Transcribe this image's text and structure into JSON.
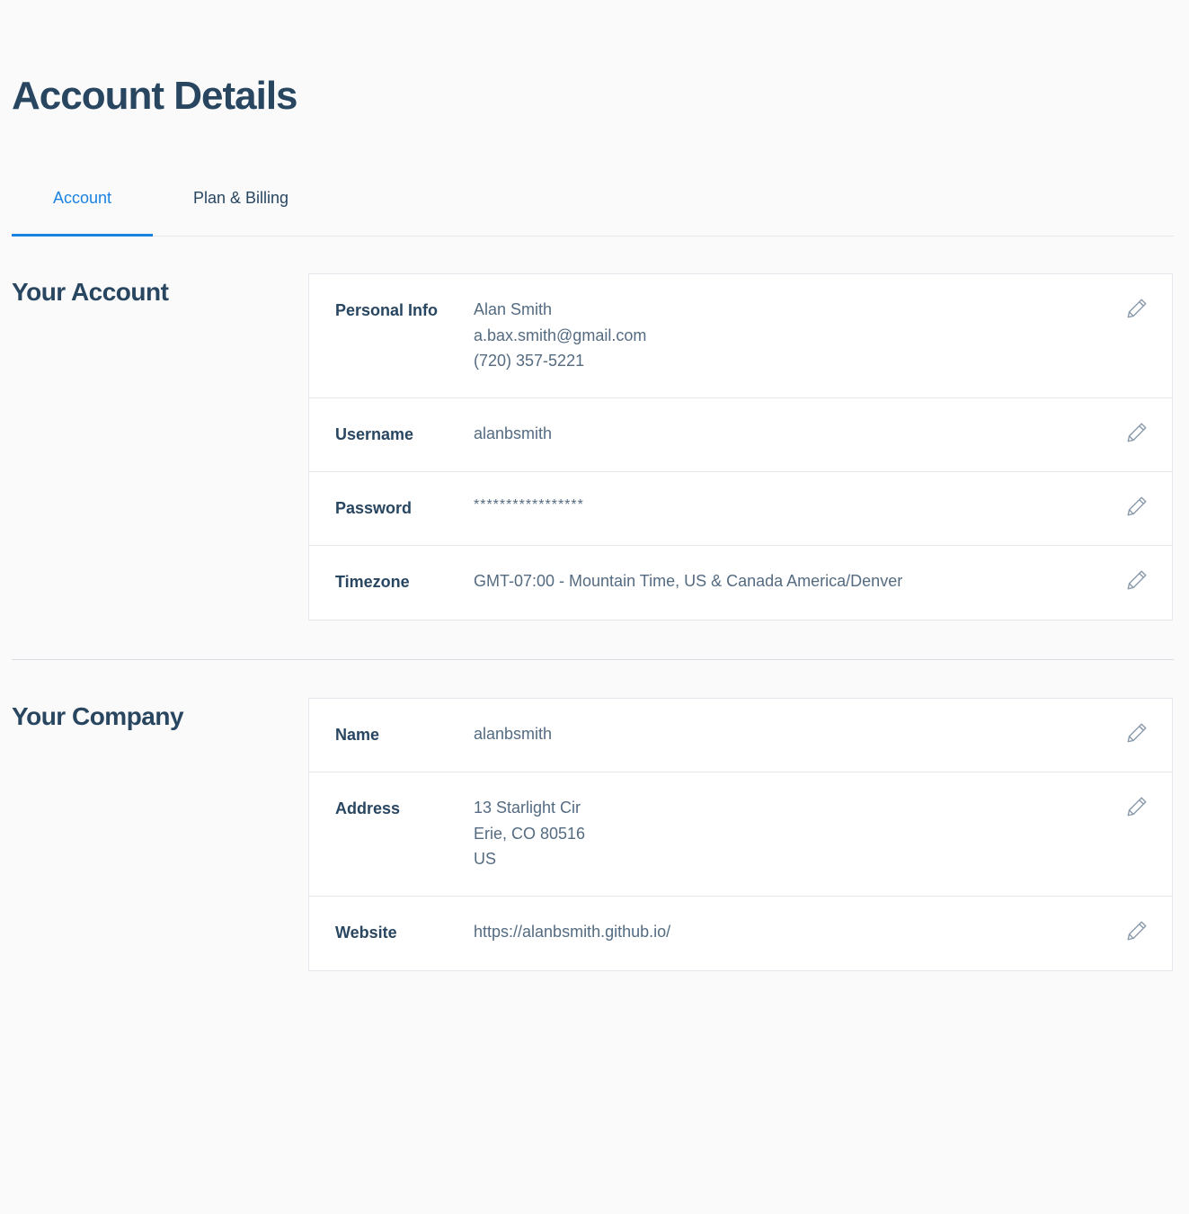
{
  "page_title": "Account Details",
  "tabs": [
    {
      "label": "Account",
      "active": true
    },
    {
      "label": "Plan & Billing",
      "active": false
    }
  ],
  "colors": {
    "heading": "#294661",
    "accent": "#1a82e2",
    "value_text": "#546b81",
    "background": "#fafafa"
  },
  "account_section": {
    "title": "Your Account",
    "rows": [
      {
        "label": "Personal Info",
        "values": [
          "Alan Smith",
          "a.bax.smith@gmail.com",
          "(720) 357-5221"
        ],
        "icon": "pencil-icon"
      },
      {
        "label": "Username",
        "values": [
          "alanbsmith"
        ],
        "icon": "pencil-icon"
      },
      {
        "label": "Password",
        "values": [
          "*****************"
        ],
        "icon": "pencil-icon"
      },
      {
        "label": "Timezone",
        "values": [
          "GMT-07:00 - Mountain Time, US & Canada America/Denver"
        ],
        "icon": "pencil-icon"
      }
    ]
  },
  "company_section": {
    "title": "Your Company",
    "rows": [
      {
        "label": "Name",
        "values": [
          "alanbsmith"
        ],
        "icon": "pencil-icon"
      },
      {
        "label": "Address",
        "values": [
          "13 Starlight Cir",
          "Erie, CO 80516",
          "US"
        ],
        "icon": "pencil-icon"
      },
      {
        "label": "Website",
        "values": [
          "https://alanbsmith.github.io/"
        ],
        "icon": "pencil-icon"
      }
    ]
  }
}
